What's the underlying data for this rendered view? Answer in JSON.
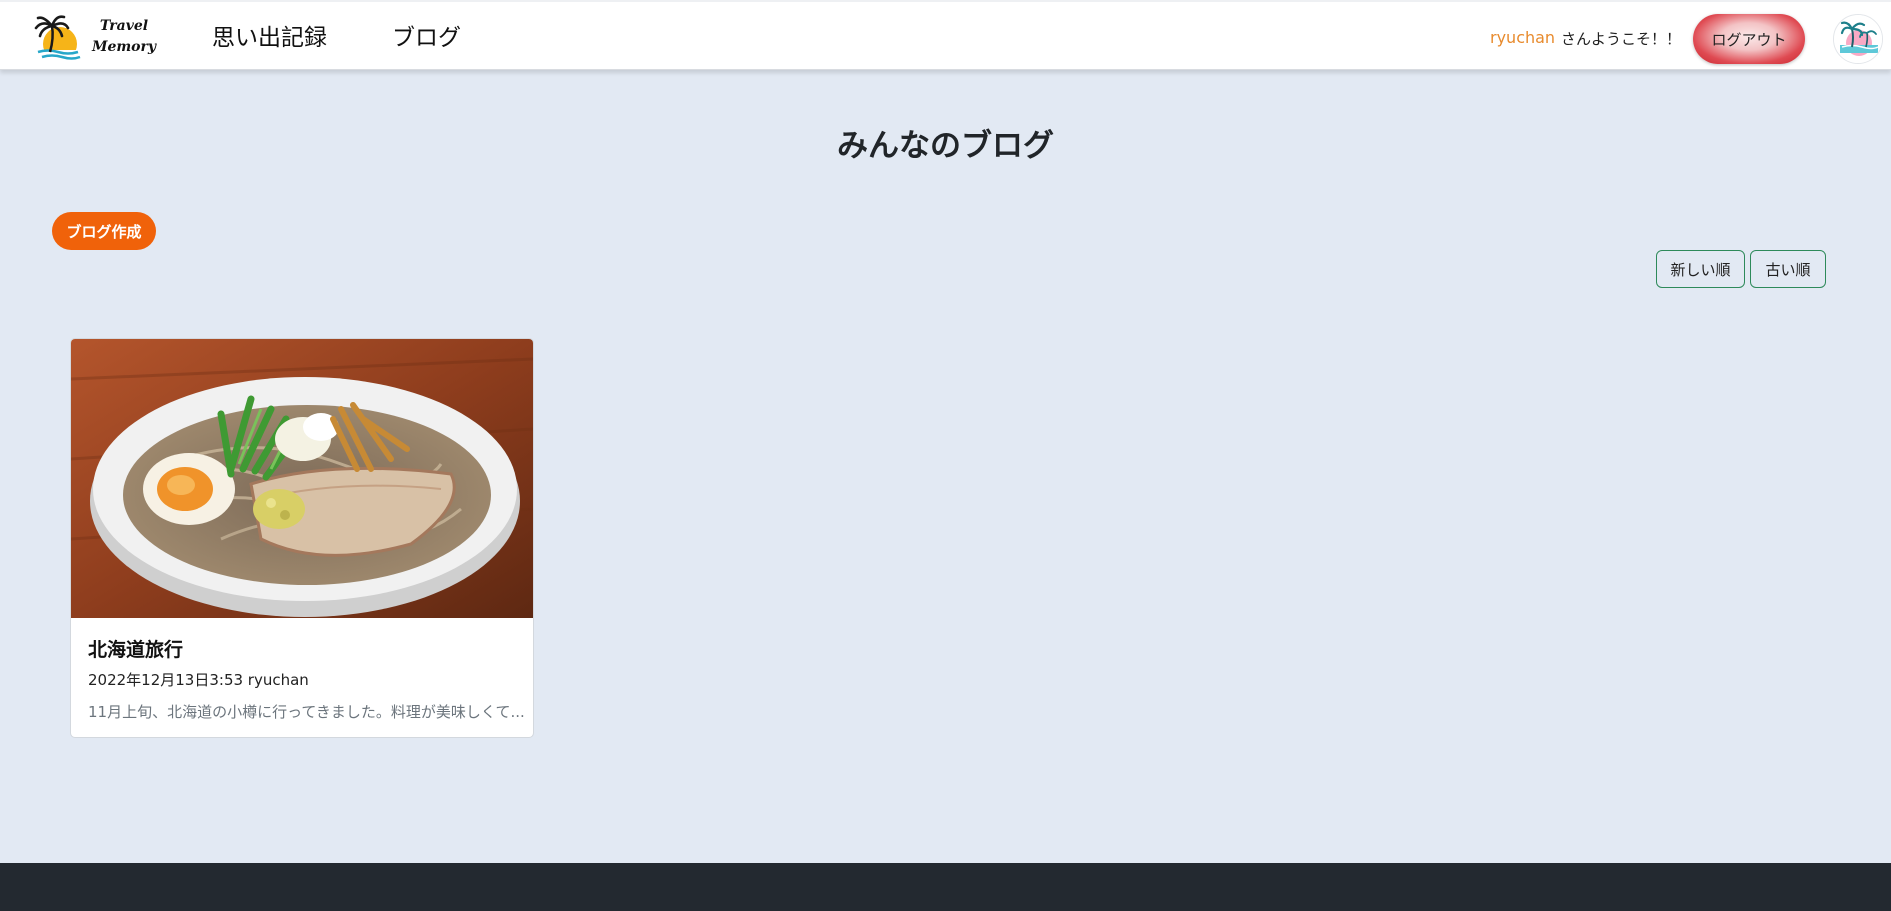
{
  "header": {
    "logo_line1": "Travel",
    "logo_line2": "Memory",
    "nav": [
      {
        "label": "思い出記録"
      },
      {
        "label": "ブログ"
      }
    ],
    "username": "ryuchan",
    "welcome": "さんようこそ！！",
    "logout_label": "ログアウト"
  },
  "main": {
    "title": "みんなのブログ",
    "create_label": "ブログ作成",
    "sort": {
      "newest_label": "新しい順",
      "oldest_label": "古い順"
    },
    "posts": [
      {
        "title": "北海道旅行",
        "meta": "2022年12月13日3:53 ryuchan",
        "excerpt": "11月上旬、北海道の小樽に行ってきました。料理が美味しくて..."
      }
    ]
  },
  "colors": {
    "background": "#e2e9f3",
    "accent_orange": "#f0620a",
    "username_orange": "#e88b2e",
    "logout_red": "#df4a52",
    "sort_border_green": "#2e8a5a",
    "footer": "#232930"
  },
  "icons": {
    "logo": "palm-tree-sunset-icon",
    "avatar": "palm-beach-icon"
  }
}
